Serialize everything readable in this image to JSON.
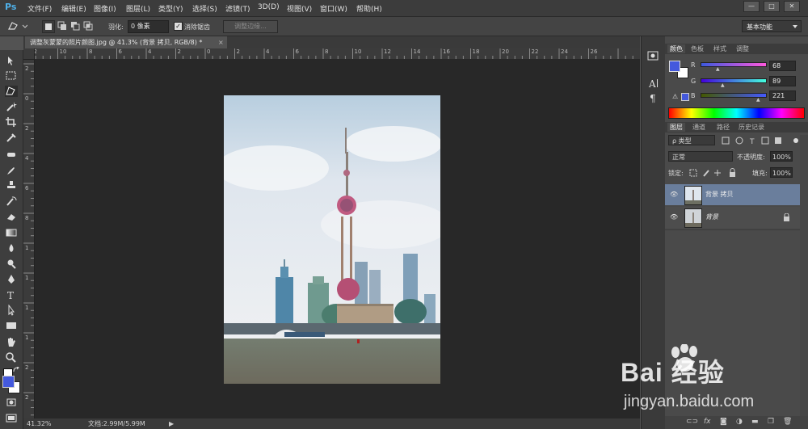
{
  "app": {
    "logo": "Ps"
  },
  "menu": [
    "文件(F)",
    "编辑(E)",
    "图像(I)",
    "图层(L)",
    "类型(Y)",
    "选择(S)",
    "滤镜(T)",
    "3D(D)",
    "视图(V)",
    "窗口(W)",
    "帮助(H)"
  ],
  "window_controls": {
    "minimize": "—",
    "maximize": "□",
    "close": "✕"
  },
  "options": {
    "feather_label": "羽化:",
    "feather_value": "0 像素",
    "antialias_label": "消除锯齿",
    "antialias_mark": "✓",
    "refine_edge_label": "调整边缘...",
    "workspace": "基本功能"
  },
  "document": {
    "tab_title": "调整灰蒙蒙的照片颜图.jpg @ 41.3% (背景 拷贝, RGB/8) *",
    "close": "×",
    "ruler_top": [
      "12",
      "10",
      "8",
      "6",
      "4",
      "2",
      "0",
      "2",
      "4",
      "6",
      "8",
      "10",
      "12",
      "14",
      "16",
      "18",
      "20",
      "22",
      "24",
      "26"
    ],
    "ruler_left": [
      "2",
      "0",
      "2",
      "4",
      "6",
      "8",
      "1",
      "1",
      "1",
      "1",
      "2",
      "2"
    ]
  },
  "status": {
    "zoom": "41.32%",
    "doc_info": "文档:2.99M/5.99M",
    "arrow": "▶"
  },
  "color_panel": {
    "tabs": [
      "颜色",
      "色板",
      "样式",
      "调整"
    ],
    "channels": [
      {
        "label": "R",
        "value": "68"
      },
      {
        "label": "G",
        "value": "89"
      },
      {
        "label": "B",
        "value": "221"
      }
    ],
    "foreground_color": "#4459dd",
    "background_color": "#ffffff"
  },
  "layers_panel": {
    "tabs": [
      "图层",
      "通道",
      "路径",
      "历史记录"
    ],
    "filter_label": "ρ 类型",
    "blend_mode": "正常",
    "opacity_label": "不透明度:",
    "opacity_value": "100%",
    "lock_label": "锁定:",
    "fill_label": "填充:",
    "fill_value": "100%",
    "layers": [
      {
        "name": "背景 拷贝",
        "selected": true
      },
      {
        "name": "背景",
        "locked": true
      }
    ],
    "bottom_icons": [
      "link-icon",
      "fx-icon",
      "mask-icon",
      "adjustment-icon",
      "group-icon",
      "new-layer-icon",
      "trash-icon"
    ],
    "fx_label": "fx"
  },
  "watermark": {
    "brand": "Bai 经验",
    "url": "jingyan.baidu.com"
  },
  "colors": {
    "accent": "#4fb0e8",
    "selected_layer": "#6a7e9c"
  }
}
